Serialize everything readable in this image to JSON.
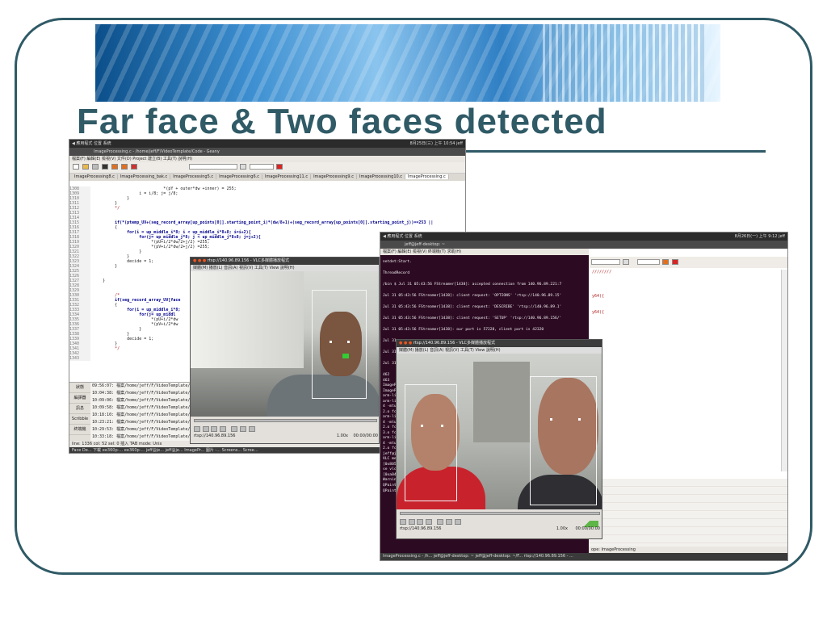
{
  "slide": {
    "title": "Far face & Two faces detected"
  },
  "geany": {
    "topbar": "◀ 應用程式 位置 系統",
    "topbar_right": "8月25日(三) 上午 10:54  jeff",
    "window_title": "ImageProcessing.c - /home/jeff/F/VideoTemplate/Code - Geany",
    "menubar": "檔案(F) 編輯(E) 檢視(V) 文件(D) Project 建立(B) 工具(T) 說明(H)",
    "tabs": [
      "ImageProcessing8.c",
      "ImageProcessing_bak.c",
      "ImageProcessing5.c",
      "ImageProcessing6.c",
      "ImageProcessing11.c",
      "ImageProcessing9.c",
      "ImageProcessing10.c",
      "ImageProcessing.c"
    ],
    "lines": [
      {
        "n": "1308",
        "code": "                              *(pY + outer*dw +inner) = 255;"
      },
      {
        "n": "1309",
        "code": "                    i = i/8; j= j/8;"
      },
      {
        "n": "1310",
        "code": "               }"
      },
      {
        "n": "1311",
        "code": "          }"
      },
      {
        "n": "1312",
        "code": "          */"
      },
      {
        "n": "1313",
        "code": ""
      },
      {
        "n": "1314",
        "code": ""
      },
      {
        "n": "1315",
        "code": "          if(*(ptemp_UV+(seg_record_array[up_points[0]].starting_point_i)*(dw/8+1)+(seg_record_array[up_points[0]].starting_point_j))==253 ||"
      },
      {
        "n": "1316",
        "code": "          {"
      },
      {
        "n": "1317",
        "code": "               for(i = up_middle_i*8; i < up_middle_i*8+8; i=i+2){"
      },
      {
        "n": "1318",
        "code": "                    for(j= up_middle_j*8; j < up_middle_j*8+8; j=j+2){"
      },
      {
        "n": "1319",
        "code": "                         *(pU+i/2*dw/2+j/2) =255;"
      },
      {
        "n": "1320",
        "code": "                         *(pV+i/2*dw/2+j/2) =255;"
      },
      {
        "n": "1321",
        "code": "                    }"
      },
      {
        "n": "1322",
        "code": "               }"
      },
      {
        "n": "1323",
        "code": "               decide = 1;"
      },
      {
        "n": "1324",
        "code": "          }"
      },
      {
        "n": "1325",
        "code": ""
      },
      {
        "n": "1326",
        "code": ""
      },
      {
        "n": "1327",
        "code": "     }"
      },
      {
        "n": "1328",
        "code": ""
      },
      {
        "n": "1329",
        "code": ""
      },
      {
        "n": "1330",
        "code": "          /*"
      },
      {
        "n": "1331",
        "code": "          if(seg_record_array_UV[face"
      },
      {
        "n": "1332",
        "code": "          {"
      },
      {
        "n": "1333",
        "code": "               for(i = up_middle_i*8;"
      },
      {
        "n": "1334",
        "code": "                    for(j= up_middl"
      },
      {
        "n": "1335",
        "code": "                         *(pU+i/2*dw"
      },
      {
        "n": "1336",
        "code": "                         *(pV+i/2*dw"
      },
      {
        "n": "1337",
        "code": "                    }"
      },
      {
        "n": "1338",
        "code": "               }"
      },
      {
        "n": "1339",
        "code": "               decide = 1;"
      },
      {
        "n": "1340",
        "code": "          }"
      },
      {
        "n": "1341",
        "code": "          */"
      },
      {
        "n": "1342",
        "code": ""
      },
      {
        "n": "1343",
        "code": ""
      }
    ],
    "msg_tabs": [
      "狀態",
      "編譯器",
      "訊息",
      "Scribble",
      "終端機"
    ],
    "messages": [
      "09:56:07: 檔案/home/jeff/F/VideoTemplate/Code/Image",
      "10:04:38: 檔案/home/jeff/F/VideoTemplate/Code/Image",
      "10:09:06: 檔案/home/jeff/F/VideoTemplate/Code/Image",
      "10:09:58: 檔案/home/jeff/F/VideoTemplate/Code/Image",
      "10:18:10: 檔案/home/jeff/F/VideoTemplate/Code/Image",
      "10:23:21: 檔案/home/jeff/F/VideoTemplate/Code/Image",
      "10:29:53: 檔案/home/jeff/F/VideoTemplate/Code/Image",
      "10:33:18: 檔案/home/jeff/F/VideoTemplate/Code/Image"
    ],
    "statusbar": "line: 1336   col: 52   sel: 0   插入   TAB   mode: Unix",
    "taskbar": "Face De...  下載  ee360p-...  ee360p-...  jeff@je...  jeff@je...  ImagePr...  圖片 -...  Screens...  Scree..."
  },
  "vlc1": {
    "title": "rtsp://140.96.89.156 - VLC多媒體播放程式",
    "menu": "媒體(M) 播放(L) 音訊(A) 視訊(V) 工具(T) View 說明(H)",
    "url": "rtsp://140.96.89.156",
    "speed": "1.00x",
    "time": "00:00/00:00"
  },
  "terminal": {
    "topbar": "◀ 應用程式 位置 系統",
    "topbar_right": "8月26日(一) 上午 9:12  jeff",
    "window_title": "jeff@jeff-desktop: ~",
    "menubar": "檔案(F) 編輯(E) 檢視(V) 終端機(T) 求助(H)",
    "lines": [
      "netdet:Start.",
      "ThreadRecord",
      "/bin $ Jul 31 05:43:56 FStreamer[1438]: accepted connection from 140.96.89.221:7",
      "Jul 31 05:43:56 FStreamer[1438]: client request: 'OPTIONS' 'rtsp://140.96.89.15'",
      "Jul 31 05:43:56 FStreamer[1438]: client request: 'DESCRIBE' 'rtsp://140.96.89.1'",
      "Jul 31 05:43:56 FStreamer[1438]: client request: 'SETUP' 'rtsp://140.96.89.156/'",
      "Jul 31 05:43:56 FStreamer[1438]: our port is 57228, client port is 42320",
      "Jul 31",
      "Jul 31",
      "Jul 31"
    ],
    "side_lines": [
      "462",
      "463",
      "ImageP",
      "ImageP",
      "arm-li",
      "arm-li",
      "4 -mtu",
      "2.o fc",
      "arm-li",
      "4 -mtu",
      "2.o fc",
      "3.o fc",
      "arm-li",
      "4 -mtu",
      "2.o fc",
      "jeff@j",
      "VLC me",
      "[0x805",
      "se vlc",
      "[0xa04",
      "Warnin",
      "QPaint"
    ],
    "bottom_line": "QPainter::begin: Paint device returned engine == 0, type: 1",
    "taskbar": "ImageProcessing.c - /h...   jeff@jeff-desktop: ~   jeff@jeff-desktop: ~/F...   rtsp://140.96.89.156 - ...",
    "right_status": "ope: ImageProcessing",
    "right_marks": [
      "////////",
      "y64){",
      "y64){",
      "){"
    ]
  },
  "vlc2": {
    "title": "rtsp://140.96.89.156 - VLC多媒體播放程式",
    "menu": "媒體(M) 播放(L) 音訊(A) 視訊(V) 工具(T) View 說明(H)",
    "url": "rtsp://140.96.89.156",
    "speed": "1.00x",
    "time": "00:00/00:00"
  }
}
